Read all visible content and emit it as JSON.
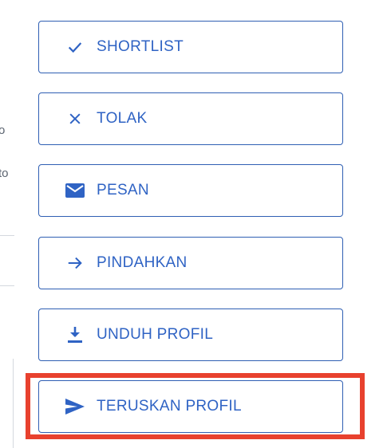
{
  "left_panel": {
    "fragment_1": "o",
    "fragment_2": "to"
  },
  "actions": [
    {
      "label": "SHORTLIST",
      "icon": "check-icon"
    },
    {
      "label": "TOLAK",
      "icon": "close-icon"
    },
    {
      "label": "PESAN",
      "icon": "mail-icon"
    },
    {
      "label": "PINDAHKAN",
      "icon": "arrow-right-icon"
    },
    {
      "label": "UNDUH PROFIL",
      "icon": "download-icon"
    },
    {
      "label": "TERUSKAN PROFIL",
      "icon": "send-icon"
    }
  ],
  "colors": {
    "accent": "#2f63c4",
    "border": "#2f5fb3",
    "highlight": "#e8412e"
  }
}
